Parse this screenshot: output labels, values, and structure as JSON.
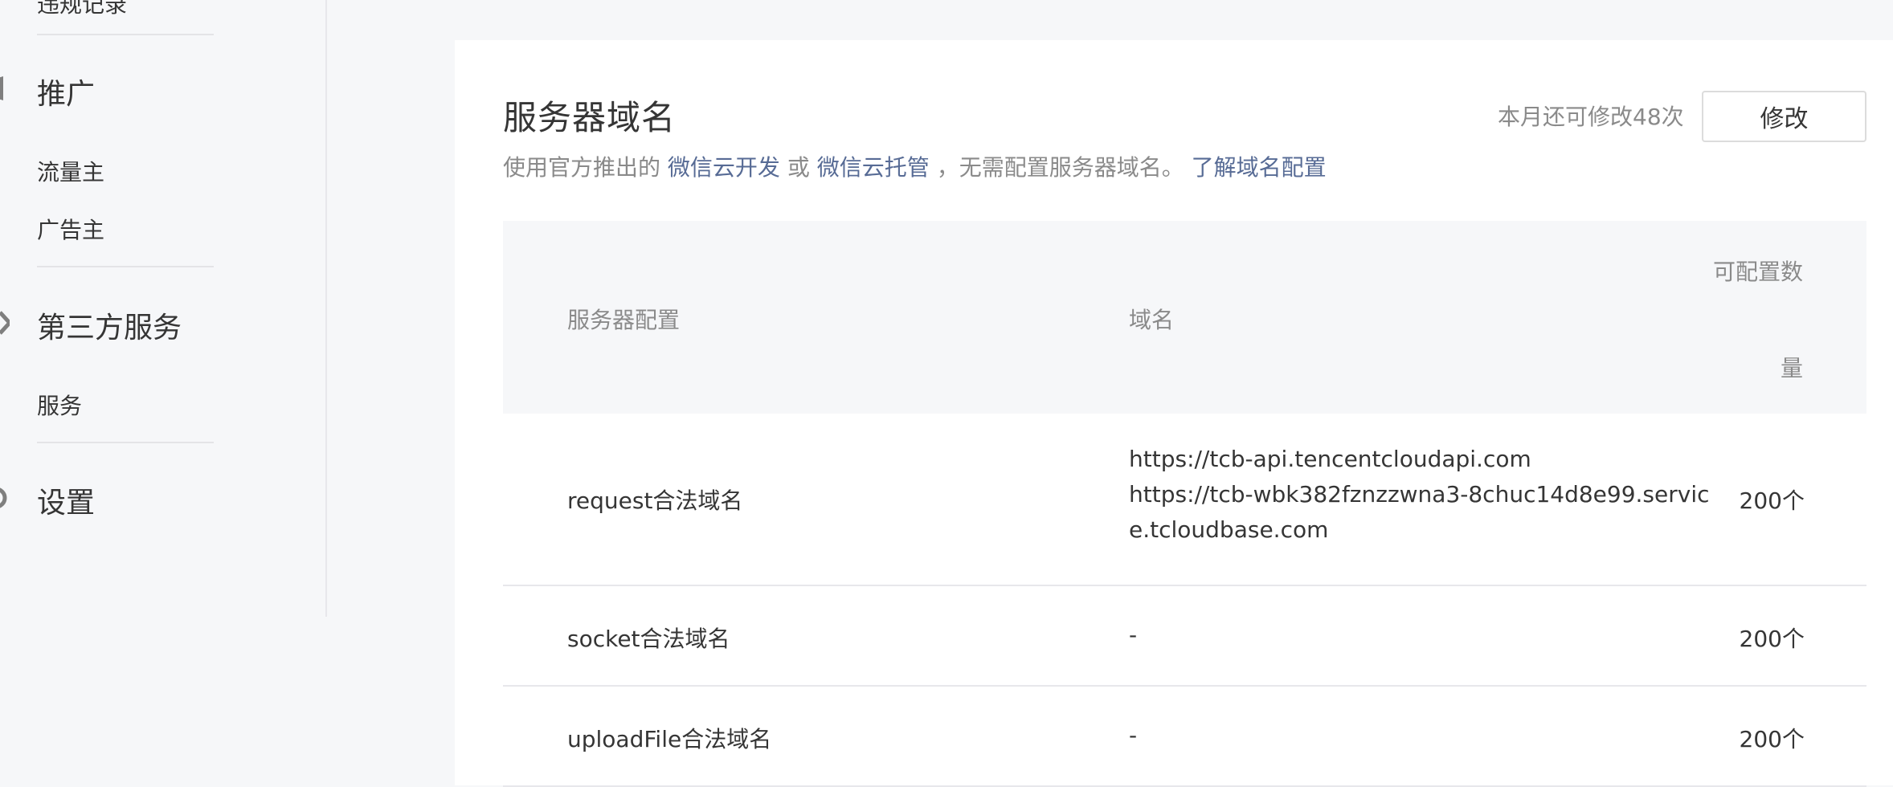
{
  "sidebar": {
    "cropped_item": "违规记录",
    "sections": [
      {
        "title": "推广",
        "icon": "promotion-icon",
        "items": [
          "流量主",
          "广告主"
        ]
      },
      {
        "title": "第三方服务",
        "icon": "plugin-icon",
        "items": [
          "服务"
        ]
      },
      {
        "title": "设置",
        "icon": "gear-icon",
        "items": []
      }
    ]
  },
  "card": {
    "title": "服务器域名",
    "desc_prefix": "使用官方推出的",
    "desc_link1": "微信云开发",
    "desc_or": "或",
    "desc_link2": "微信云托管",
    "desc_suffix": "，无需配置服务器域名。",
    "desc_learn_link": "了解域名配置",
    "quota_text": "本月还可修改48次",
    "modify_button": "修改"
  },
  "table": {
    "headers": {
      "config": "服务器配置",
      "domain": "域名",
      "count_line1": "可配置数",
      "count_line2": "量"
    },
    "rows": [
      {
        "name": "request合法域名",
        "domain_lines": [
          "https://tcb-api.tencentcloudapi.com",
          "https://tcb-wbk382fznzzwna3-8chuc14d8e99.servic",
          "e.tcloudbase.com"
        ],
        "count": "200个"
      },
      {
        "name": "socket合法域名",
        "domain_lines": [
          "-"
        ],
        "count": "200个"
      },
      {
        "name": "uploadFile合法域名",
        "domain_lines": [
          "-"
        ],
        "count": "200个"
      }
    ]
  }
}
